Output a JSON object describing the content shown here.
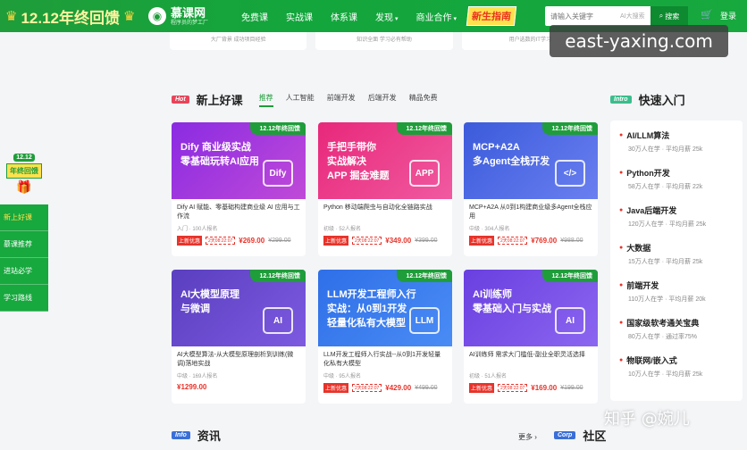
{
  "topbar": {
    "promo": "12.12年终回馈",
    "logo_name": "慕课网",
    "logo_slogan": "程序员的梦工厂",
    "nav": [
      "免费课",
      "实战课",
      "体系课",
      "发现",
      "商业合作"
    ],
    "newbie": "新生指南",
    "search_placeholder": "请输入关键字",
    "search_ai": "AI大搜索",
    "search_button": "搜索",
    "login": "登录"
  },
  "prev_strip": [
    "大厂背景 成功项目经验",
    "知识全面 学习必有帮助",
    "用户选数的IT学习"
  ],
  "watermark": "east-yaxing.com",
  "float": {
    "year": "12.12",
    "banner": "年终回馈",
    "items": [
      "新上好课",
      "慕课推荐",
      "进站必学",
      "学习路线"
    ]
  },
  "section": {
    "tag": "Hot",
    "title": "新上好课",
    "tabs": [
      "推荐",
      "人工智能",
      "前端开发",
      "后端开发",
      "精品免费"
    ]
  },
  "cards": [
    {
      "ribbon": "12.12年终回馈",
      "banner_text": "Dify 商业级实战\n零基础玩转AI应用",
      "icon": "Dify",
      "color": "#8a2be2",
      "color2": "#c04ad8",
      "title": "Dify AI 赋能、零基础构建商业级 AI 应用与工作流",
      "meta": "入门 · 100人报名",
      "badge": "上新优惠",
      "count": "2天08:22:07",
      "price": "¥269.00",
      "old_price": "¥299.00"
    },
    {
      "ribbon": "12.12年终回馈",
      "banner_text": "手把手带你\n实战解决\nAPP 掘金难题",
      "icon": "APP",
      "color": "#e8287a",
      "color2": "#f05aa0",
      "title": "Python 移动端爬虫与自动化全链路实战",
      "meta": "初级 · 52人报名",
      "badge": "上新优惠",
      "count": "2天08:22:07",
      "price": "¥349.00",
      "old_price": "¥399.00"
    },
    {
      "ribbon": "12.12年终回馈",
      "banner_text": "MCP+A2A\n多Agent全栈开发",
      "icon": "</>",
      "color": "#3b5bdb",
      "color2": "#6a7ff0",
      "title": "MCP+A2A 从0到1构建商业级多Agent全栈应用",
      "meta": "中级 · 304人报名",
      "badge": "上新优惠",
      "count": "2天08:22:07",
      "price": "¥769.00",
      "old_price": "¥988.00"
    },
    {
      "ribbon": "12.12年终回馈",
      "banner_text": "AI大模型原理\n与微调",
      "icon": "AI",
      "color": "#5a3fc0",
      "color2": "#7d5ae0",
      "title": "AI大模型算法-从大模型原理剖析到训练(微调)落地实战",
      "meta": "中级 · 169人报名",
      "badge": "",
      "count": "",
      "price": "¥1299.00",
      "old_price": ""
    },
    {
      "ribbon": "12.12年终回馈",
      "banner_text": "LLM开发工程师入行\n实战：从0到1开发\n轻量化私有大模型",
      "icon": "LLM",
      "color": "#2f6fe8",
      "color2": "#4a8cf5",
      "title": "LLM开发工程师入行实战--从0到1开发轻量化私有大模型",
      "meta": "中级 · 95人报名",
      "badge": "上新优惠",
      "count": "2天08:22:07",
      "price": "¥429.00",
      "old_price": "¥499.00"
    },
    {
      "ribbon": "12.12年终回馈",
      "banner_text": "AI训练师\n零基础入门与实战",
      "icon": "AI",
      "color": "#6a3fe0",
      "color2": "#8b66f0",
      "title": "AI训练师 需求大门槛低-副业全职灵活选择",
      "meta": "初级 · 51人报名",
      "badge": "上新优惠",
      "count": "2天08:22:07",
      "price": "¥169.00",
      "old_price": "¥199.00"
    }
  ],
  "quick": {
    "tag": "Intro",
    "title": "快速入门",
    "items": [
      {
        "name": "AI/LLM算法",
        "stat": "30万人在学 · 平均月薪 25k"
      },
      {
        "name": "Python开发",
        "stat": "58万人在学 · 平均月薪 22k"
      },
      {
        "name": "Java后端开发",
        "stat": "120万人在学 · 平均月薪 25k"
      },
      {
        "name": "大数据",
        "stat": "15万人在学 · 平均月薪 25k"
      },
      {
        "name": "前端开发",
        "stat": "110万人在学 · 平均月薪 20k"
      },
      {
        "name": "国家级软考通关宝典",
        "stat": "80万人在学 · 通过率75%"
      },
      {
        "name": "物联网/嵌入式",
        "stat": "10万人在学 · 平均月薪 25k"
      }
    ]
  },
  "bottom": {
    "info_tag": "Info",
    "info_title": "资讯",
    "more": "更多 ›",
    "corp_tag": "Corp",
    "corp_title": "社区",
    "zhihu": "知乎 @婉儿"
  }
}
